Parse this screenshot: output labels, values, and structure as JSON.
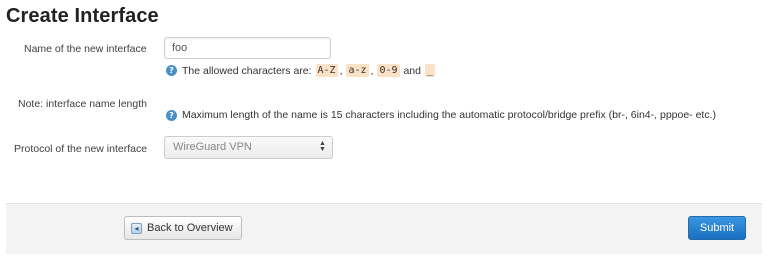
{
  "page": {
    "title": "Create Interface"
  },
  "form": {
    "name_label": "Name of the new interface",
    "name_value": "foo",
    "allowed_prefix": "The allowed characters are:",
    "allowed_chars": [
      "A-Z",
      "a-z",
      "0-9",
      "_"
    ],
    "comma1": ",",
    "comma2": ",",
    "and_word": "and",
    "note_label": "Note: interface name length",
    "note_text": "Maximum length of the name is 15 characters including the automatic protocol/bridge prefix (br-, 6in4-, pppoe- etc.)",
    "protocol_label": "Protocol of the new interface",
    "protocol_selected": "WireGuard VPN"
  },
  "footer": {
    "back_label": "Back to Overview",
    "submit_label": "Submit"
  },
  "colors": {
    "accent": "#1b6fc0",
    "code_highlight": "#fbe1c6",
    "info_icon": "#4a90c8"
  }
}
